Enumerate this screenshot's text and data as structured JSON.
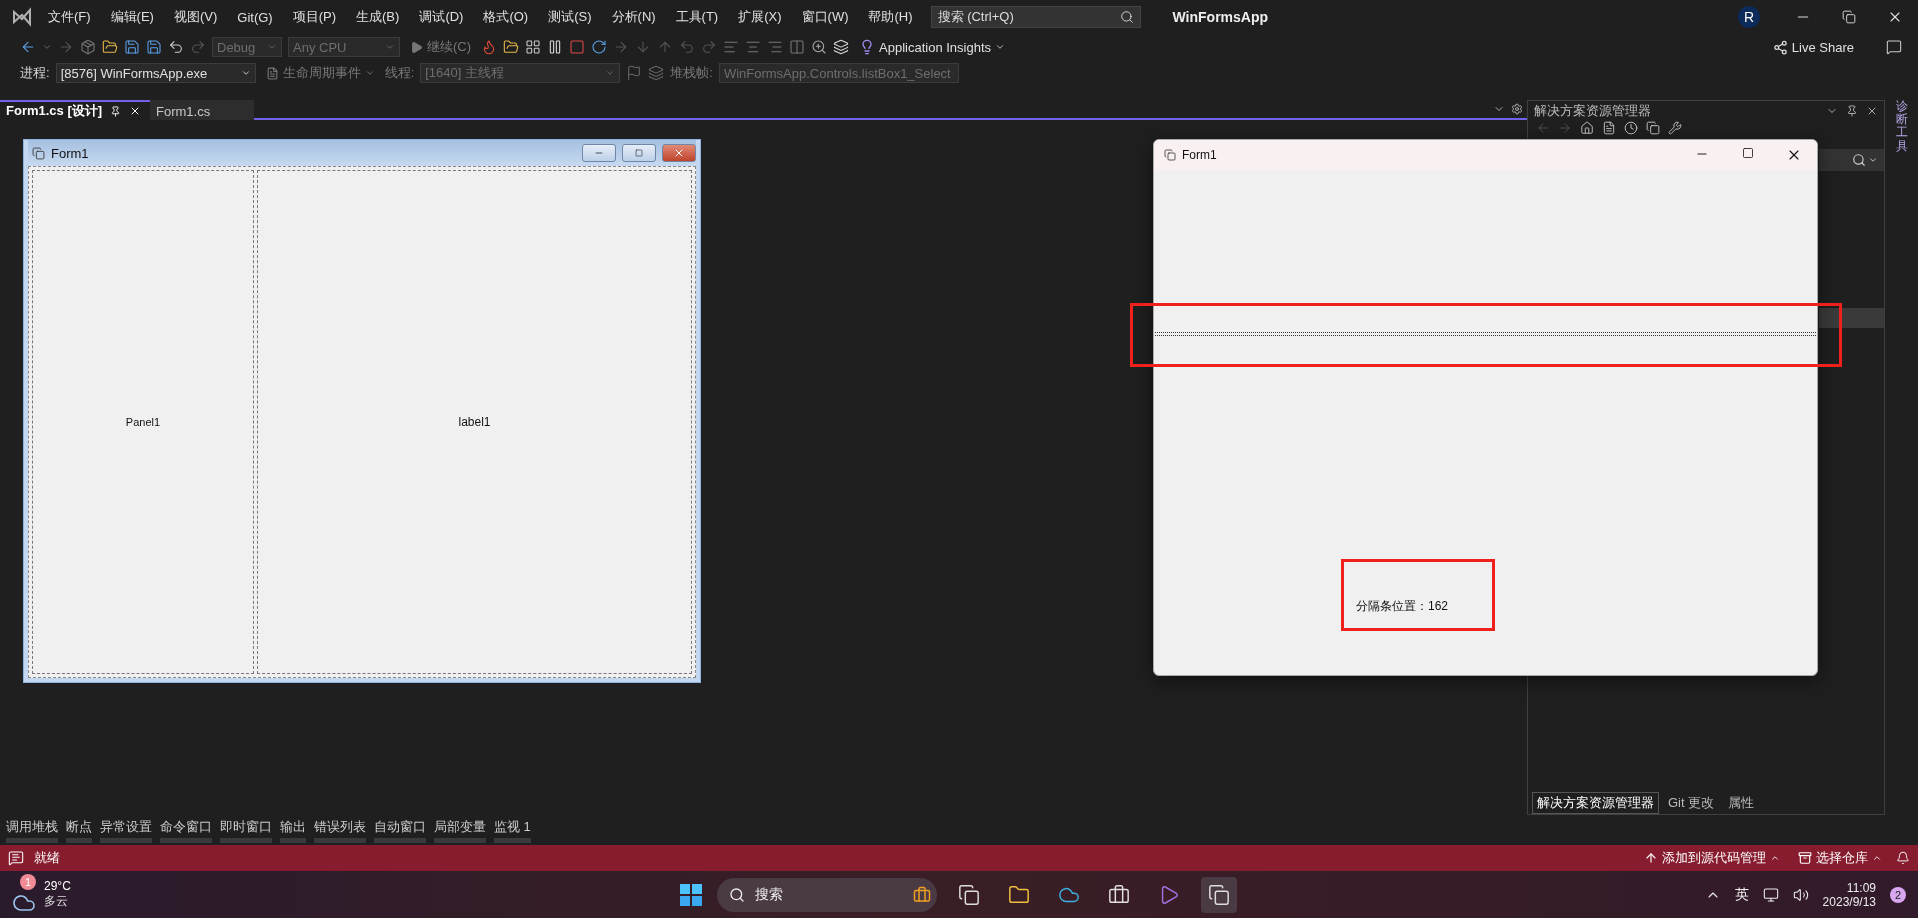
{
  "app": {
    "title": "WinFormsApp",
    "account_initial": "R"
  },
  "menu": [
    "文件(F)",
    "编辑(E)",
    "视图(V)",
    "Git(G)",
    "项目(P)",
    "生成(B)",
    "调试(D)",
    "格式(O)",
    "测试(S)",
    "分析(N)",
    "工具(T)",
    "扩展(X)",
    "窗口(W)",
    "帮助(H)"
  ],
  "search": {
    "placeholder": "搜索 (Ctrl+Q)"
  },
  "toolbar": {
    "configuration": "Debug",
    "platform": "Any CPU",
    "continue": "继续(C)",
    "app_insights": "Application Insights",
    "live_share": "Live Share"
  },
  "debug_bar": {
    "process_label": "进程:",
    "process": "[8576] WinFormsApp.exe",
    "lifecycle": "生命周期事件",
    "thread_label": "线程:",
    "thread": "[1640] 主线程",
    "stack_label": "堆栈帧:",
    "stack": "WinFormsApp.Controls.listBox1_Select"
  },
  "doc_tabs": [
    {
      "label": "Form1.cs [设计]",
      "selected": true
    },
    {
      "label": "Form1.cs",
      "selected": false
    }
  ],
  "designer": {
    "title": "Form1",
    "panel_1": "Panel1",
    "panel_2": "label1"
  },
  "running_form": {
    "title": "Form1",
    "label": "分隔条位置：162"
  },
  "solution_explorer": {
    "title": "解决方案资源管理器",
    "tabs": [
      {
        "label": "解决方案资源管理器",
        "selected": true
      },
      {
        "label": "Git 更改",
        "selected": false
      },
      {
        "label": "属性",
        "selected": false
      }
    ]
  },
  "side_tool": "诊断工具",
  "bottom_tabs": [
    "调用堆栈",
    "断点",
    "异常设置",
    "命令窗口",
    "即时窗口",
    "输出",
    "错误列表",
    "自动窗口",
    "局部变量",
    "监视 1"
  ],
  "status_bar": {
    "text": "就绪",
    "source_control": "添加到源代码管理",
    "repo": "选择仓库"
  },
  "taskbar": {
    "temperature": "29°C",
    "weather": "多云",
    "weather_badge": "1",
    "search": "搜索",
    "ime": "英",
    "time": "11:09",
    "date": "2023/9/13",
    "notifications": "2"
  }
}
